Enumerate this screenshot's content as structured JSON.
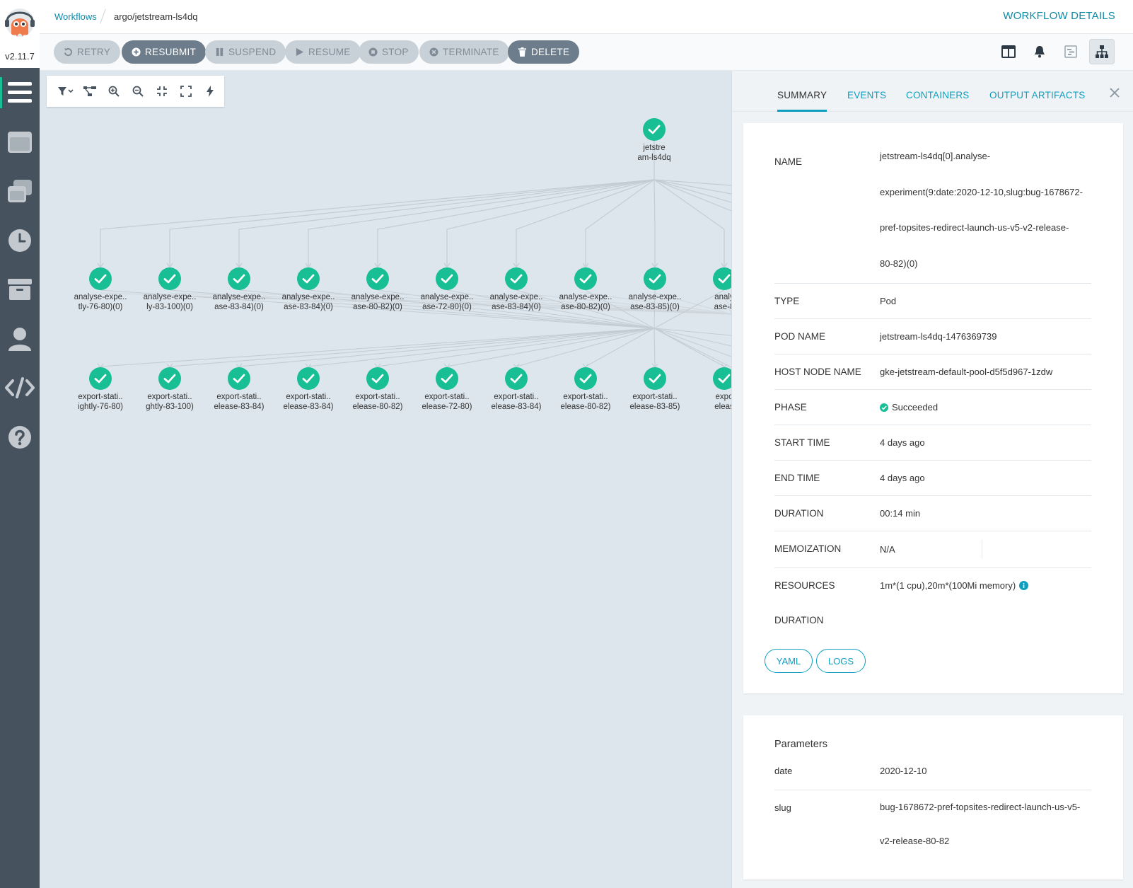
{
  "nav": {
    "version": "v2.11.7",
    "items": [
      {
        "icon": "workflows-icon",
        "active": true
      },
      {
        "icon": "workflow-templates-icon",
        "active": false
      },
      {
        "icon": "cluster-workflow-templates-icon",
        "active": false
      },
      {
        "icon": "cron-workflows-icon",
        "active": false
      },
      {
        "icon": "archived-workflows-icon",
        "active": false
      },
      {
        "icon": "user-icon",
        "active": false
      },
      {
        "icon": "api-docs-icon",
        "active": false
      },
      {
        "icon": "help-icon",
        "active": false
      }
    ]
  },
  "breadcrumb": {
    "link": "Workflows",
    "current": "argo/jetstream-ls4dq"
  },
  "page_title": "WORKFLOW DETAILS",
  "actions": {
    "retry": "RETRY",
    "resubmit": "RESUBMIT",
    "suspend": "SUSPEND",
    "resume": "RESUME",
    "stop": "STOP",
    "terminate": "TERMINATE",
    "delete": "DELETE"
  },
  "graph": {
    "root": {
      "line1": "jetstre",
      "line2": "am-ls4dq"
    },
    "row1": [
      {
        "line1": "analyse-expe..",
        "line2": "tly-76-80)(0)"
      },
      {
        "line1": "analyse-expe..",
        "line2": "ly-83-100)(0)"
      },
      {
        "line1": "analyse-expe..",
        "line2": "ase-83-84)(0)"
      },
      {
        "line1": "analyse-expe..",
        "line2": "ase-83-84)(0)"
      },
      {
        "line1": "analyse-expe..",
        "line2": "ase-80-82)(0)"
      },
      {
        "line1": "analyse-expe..",
        "line2": "ase-72-80)(0)"
      },
      {
        "line1": "analyse-expe..",
        "line2": "ase-83-84)(0)"
      },
      {
        "line1": "analyse-expe..",
        "line2": "ase-80-82)(0)"
      },
      {
        "line1": "analyse-expe..",
        "line2": "ase-83-85)(0)"
      },
      {
        "line1": "analy",
        "line2": "ase-8"
      }
    ],
    "row2": [
      {
        "line1": "export-stati..",
        "line2": "ightly-76-80)"
      },
      {
        "line1": "export-stati..",
        "line2": "ghtly-83-100)"
      },
      {
        "line1": "export-stati..",
        "line2": "elease-83-84)"
      },
      {
        "line1": "export-stati..",
        "line2": "elease-83-84)"
      },
      {
        "line1": "export-stati..",
        "line2": "elease-80-82)"
      },
      {
        "line1": "export-stati..",
        "line2": "elease-72-80)"
      },
      {
        "line1": "export-stati..",
        "line2": "elease-83-84)"
      },
      {
        "line1": "export-stati..",
        "line2": "elease-80-82)"
      },
      {
        "line1": "export-stati..",
        "line2": "elease-83-85)"
      },
      {
        "line1": "expo",
        "line2": "eleas"
      }
    ],
    "status_color": "#18be94"
  },
  "panel": {
    "tabs": [
      "SUMMARY",
      "EVENTS",
      "CONTAINERS",
      "OUTPUT ARTIFACTS"
    ],
    "summary": {
      "name_label": "NAME",
      "name_value": "jetstream-ls4dq[0].analyse-experiment(9:date:2020-12-10,slug:bug-1678672-pref-topsites-redirect-launch-us-v5-v2-release-80-82)(0)",
      "name_lines": [
        "jetstream-ls4dq[0].analyse-",
        "experiment(9:date:2020-12-10,slug:bug-1678672-",
        "pref-topsites-redirect-launch-us-v5-v2-release-",
        "80-82)(0)"
      ],
      "type_label": "TYPE",
      "type_value": "Pod",
      "pod_name_label": "POD NAME",
      "pod_name_value": "jetstream-ls4dq-1476369739",
      "host_node_label": "HOST NODE NAME",
      "host_node_value": "gke-jetstream-default-pool-d5f5d967-1zdw",
      "phase_label": "PHASE",
      "phase_value": "Succeeded",
      "start_label": "START TIME",
      "start_value": "4 days ago",
      "end_label": "END TIME",
      "end_value": "4 days ago",
      "duration_label": "DURATION",
      "duration_value": "00:14 min",
      "memo_label": "MEMOIZATION",
      "memo_value": "N/A",
      "resources_label": "RESOURCES",
      "resources_value": "1m*(1 cpu),20m*(100Mi memory)",
      "resources_label2": "DURATION",
      "yaml_button": "YAML",
      "logs_button": "LOGS"
    },
    "parameters": {
      "title": "Parameters",
      "items": [
        {
          "key": "date",
          "value": "2020-12-10",
          "lines": [
            "2020-12-10"
          ]
        },
        {
          "key": "slug",
          "value": "bug-1678672-pref-topsites-redirect-launch-us-v5-v2-release-80-82",
          "lines": [
            "bug-1678672-pref-topsites-redirect-launch-us-v5-",
            "v2-release-80-82"
          ]
        }
      ]
    }
  }
}
